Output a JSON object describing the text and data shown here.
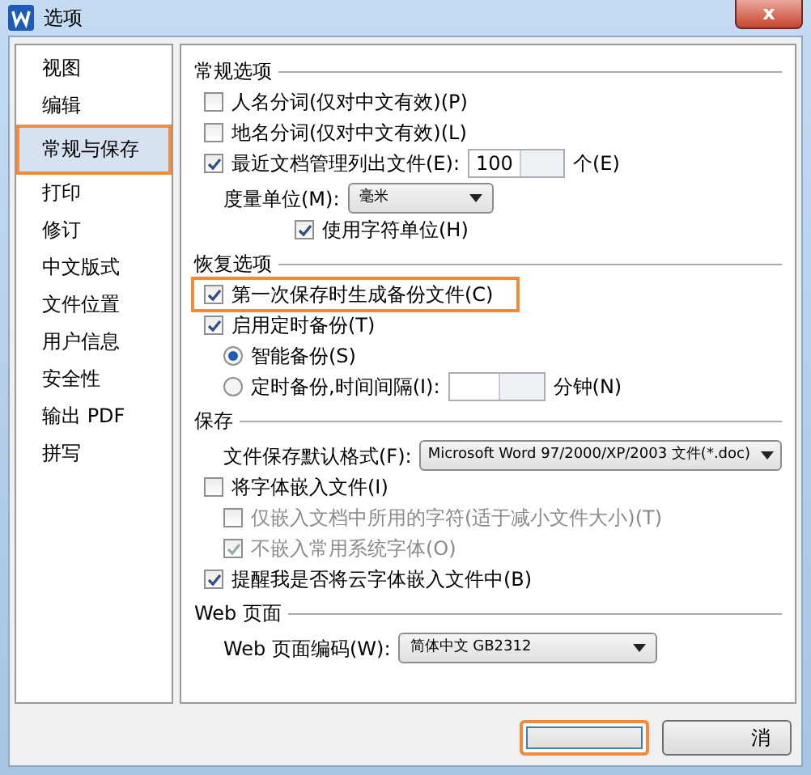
{
  "window": {
    "title": "选项",
    "close": "x"
  },
  "sidebar": {
    "items": [
      {
        "label": "视图",
        "selected": false
      },
      {
        "label": "编辑",
        "selected": false
      },
      {
        "label": "常规与保存",
        "selected": true
      },
      {
        "label": "打印",
        "selected": false
      },
      {
        "label": "修订",
        "selected": false
      },
      {
        "label": "中文版式",
        "selected": false
      },
      {
        "label": "文件位置",
        "selected": false
      },
      {
        "label": "用户信息",
        "selected": false
      },
      {
        "label": "安全性",
        "selected": false
      },
      {
        "label": "输出 PDF",
        "selected": false
      },
      {
        "label": "拼写",
        "selected": false
      }
    ]
  },
  "sections": [
    {
      "title": "常规选项",
      "rows": [
        {
          "kind": "checkbox",
          "label": "人名分词(仅对中文有效)(P)",
          "checked": false,
          "indented": false,
          "disabled": false,
          "highlighted": false
        },
        {
          "kind": "checkbox",
          "label": "地名分词(仅对中文有效)(L)",
          "checked": false,
          "indented": false,
          "disabled": false,
          "highlighted": false
        },
        {
          "kind": "spin",
          "label": "最近文档管理列出文件(E):",
          "checked": true,
          "value": "100",
          "suffix": "个(E)"
        },
        {
          "kind": "select",
          "label": "度量单位(M):",
          "value": "毫米"
        },
        {
          "kind": "checkbox",
          "label": "使用字符单位(H)",
          "checked": true,
          "indented": true,
          "disabled": false,
          "highlighted": false
        }
      ]
    },
    {
      "title": "恢复选项",
      "rows": [
        {
          "kind": "checkbox",
          "label": "第一次保存时生成备份文件(C)",
          "checked": true,
          "indented": false,
          "disabled": false,
          "highlighted": true
        },
        {
          "kind": "checkbox",
          "label": "启用定时备份(T)",
          "checked": true,
          "indented": false,
          "disabled": false,
          "highlighted": false
        },
        {
          "kind": "radio",
          "label": "智能备份(S)",
          "selected": true
        },
        {
          "kind": "radio-spin",
          "label": "定时备份,时间间隔(I):",
          "selected": false,
          "suffix": "分钟(N)"
        }
      ]
    },
    {
      "title": "保存",
      "rows": [
        {
          "kind": "select",
          "label": "文件保存默认格式(F):",
          "value": "Microsoft Word 97/2000/XP/2003 文件(*.doc)"
        },
        {
          "kind": "checkbox",
          "label": "将字体嵌入文件(I)",
          "checked": false,
          "indented": false,
          "disabled": false,
          "highlighted": false
        },
        {
          "kind": "checkbox",
          "label": "仅嵌入文档中所用的字符(适于减小文件大小)(T)",
          "checked": false,
          "indented": true,
          "disabled": true,
          "highlighted": false
        },
        {
          "kind": "checkbox",
          "label": "不嵌入常用系统字体(O)",
          "checked": true,
          "indented": true,
          "disabled": true,
          "highlighted": false
        },
        {
          "kind": "checkbox",
          "label": "提醒我是否将云字体嵌入文件中(B)",
          "checked": true,
          "indented": false,
          "disabled": false,
          "highlighted": false
        }
      ]
    },
    {
      "title": "Web 页面",
      "rows": [
        {
          "kind": "select",
          "label": "Web 页面编码(W):",
          "value": "简体中文 GB2312"
        }
      ]
    }
  ],
  "buttons": [
    {
      "kind": "ok",
      "highlighted": true
    },
    {
      "kind": "cancel",
      "label": "消",
      "highlighted": false
    }
  ]
}
